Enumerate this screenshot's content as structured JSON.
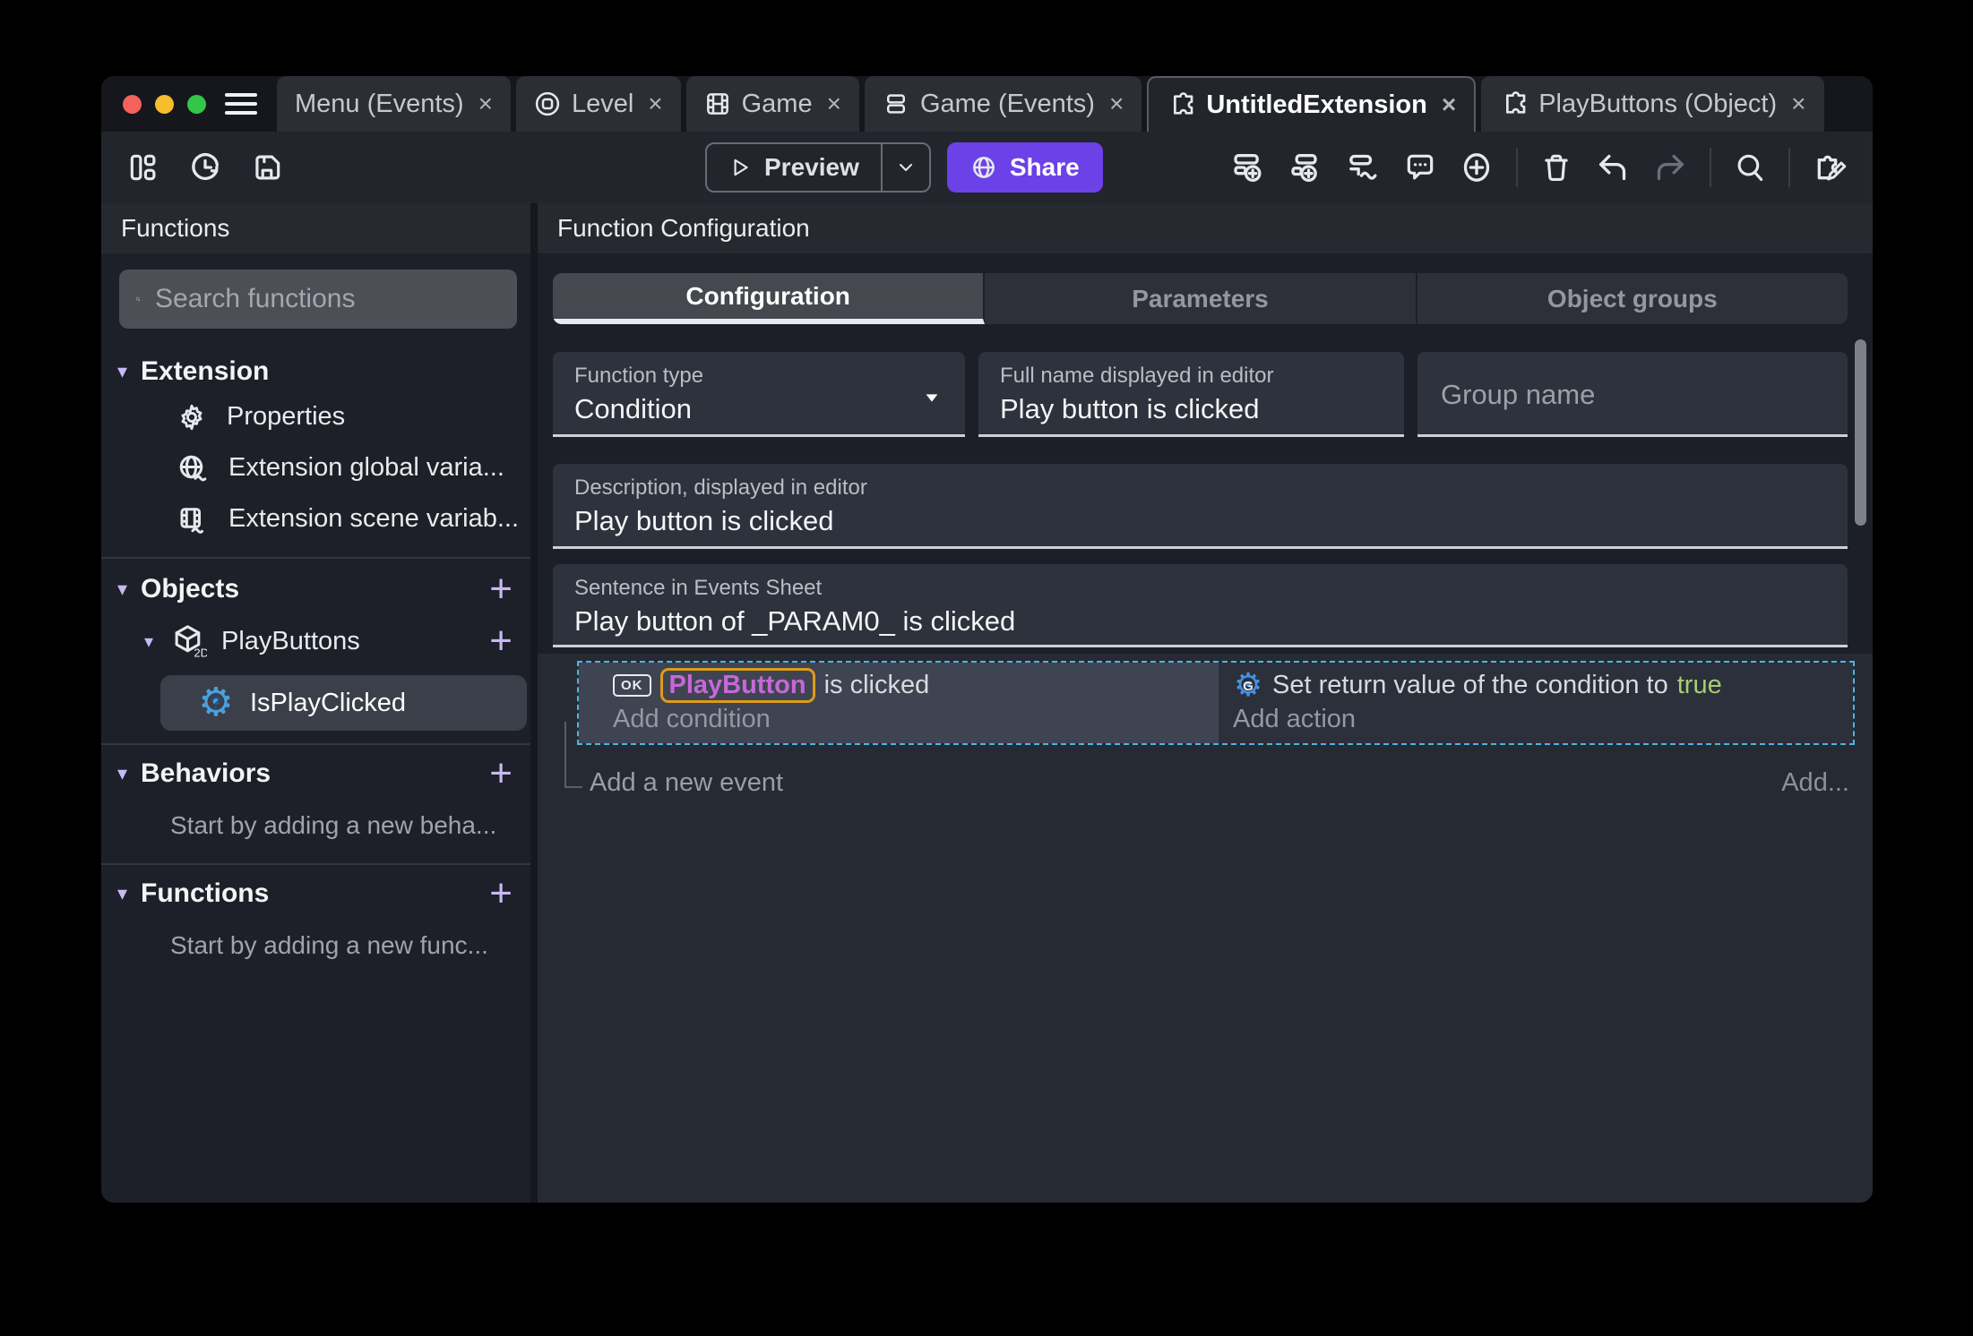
{
  "titlebar": {
    "close_glyph": "×",
    "tabs": [
      {
        "label": "Menu (Events)"
      },
      {
        "label": "Level"
      },
      {
        "label": "Game"
      },
      {
        "label": "Game (Events)"
      },
      {
        "label": "UntitledExtension"
      },
      {
        "label": "PlayButtons (Object)"
      }
    ]
  },
  "toolbar": {
    "preview_label": "Preview",
    "share_label": "Share"
  },
  "sidebar": {
    "header": "Functions",
    "search_placeholder": "Search functions",
    "expander_glyph": "▾",
    "plus_glyph": "+",
    "extension_section": "Extension",
    "properties_label": "Properties",
    "global_vars_label": "Extension global varia...",
    "scene_vars_label": "Extension scene variab...",
    "objects_section": "Objects",
    "playbuttons_label": "PlayButtons",
    "playbuttons_badge": "2D",
    "isplayclicked_label": "IsPlayClicked",
    "isplayclicked_glyph": "?",
    "behaviors_section": "Behaviors",
    "behaviors_hint": "Start by adding a new beha...",
    "functions_section": "Functions",
    "functions_hint": "Start by adding a new func..."
  },
  "main": {
    "header": "Function Configuration",
    "tabs": [
      {
        "label": "Configuration"
      },
      {
        "label": "Parameters"
      },
      {
        "label": "Object groups"
      }
    ],
    "fields": {
      "function_type_label": "Function type",
      "function_type_value": "Condition",
      "full_name_label": "Full name displayed in editor",
      "full_name_value": "Play button is clicked",
      "group_name_placeholder": "Group name",
      "description_label": "Description, displayed in editor",
      "description_value": "Play button is clicked",
      "sentence_label": "Sentence in Events Sheet",
      "sentence_value": "Play button of _PARAM0_ is clicked"
    },
    "events": {
      "condition_ok_badge": "OK",
      "condition_object": "PlayButton",
      "condition_text": "is clicked",
      "add_condition": "Add condition",
      "action_gear_glyph": "G",
      "action_text": "Set return value of the condition to ",
      "action_value": "true",
      "add_action": "Add action",
      "add_new_event": "Add a new event",
      "add_more": "Add..."
    }
  },
  "colors": {
    "share_purple": "#6c41e8",
    "object_text_purple": "#c668d8",
    "object_border_orange": "#dd9b19",
    "true_green": "#a8cd74",
    "selection_dashed_blue": "#4fb3e8",
    "accent_lavender": "#c9b9f2"
  }
}
